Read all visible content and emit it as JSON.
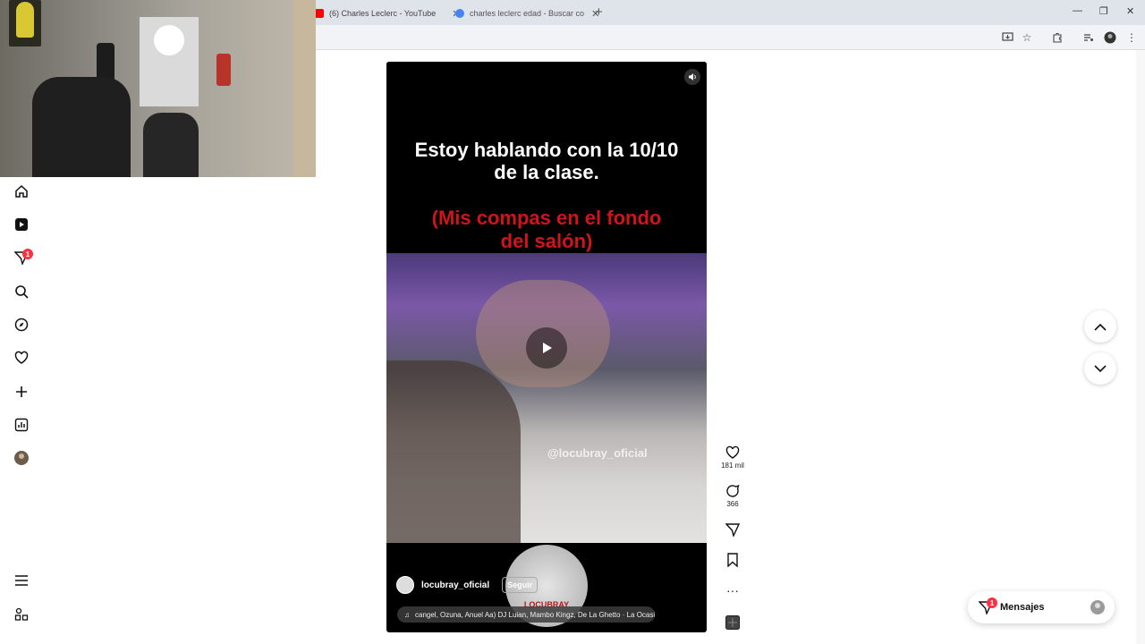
{
  "browser": {
    "tabs": [
      {
        "title": "(6) Charles Leclerc - YouTube",
        "favicon_color": "#ff0000"
      },
      {
        "title": "charles leclerc edad - Buscar co",
        "favicon_color": "#4285f4"
      }
    ],
    "new_tab": "+",
    "window_controls": [
      "—",
      "❐",
      "✕"
    ]
  },
  "sidebar": {
    "items": [
      {
        "name": "home-icon"
      },
      {
        "name": "reels-icon"
      },
      {
        "name": "messages-icon",
        "badge": "1"
      },
      {
        "name": "search-icon"
      },
      {
        "name": "explore-icon"
      },
      {
        "name": "notifications-icon"
      },
      {
        "name": "create-icon"
      },
      {
        "name": "dashboard-icon"
      },
      {
        "name": "profile-avatar"
      }
    ],
    "bottom": [
      {
        "name": "menu-icon"
      },
      {
        "name": "more-apps-icon"
      }
    ]
  },
  "reel": {
    "caption_line1": "Estoy hablando con la 10/10",
    "caption_line2": "de la clase.",
    "caption_red_line1": "(Mis compas en el fondo",
    "caption_red_line2": "del salón)",
    "watermark": "@locubray_oficial",
    "author": "locubray_oficial",
    "follow_label": "Seguir",
    "audio": "cangel, Ozuna, Anuel Aa)  DJ Luian, Mambo Kingz, De La Ghetto · La Ocasi",
    "logo_text": "LOCUBRAY"
  },
  "actions": {
    "likes": "181 mil",
    "comments": "366"
  },
  "messages": {
    "label": "Mensajes",
    "badge": "1"
  },
  "colors": {
    "accent_red": "#ff3040",
    "caption_red": "#d0141b"
  }
}
